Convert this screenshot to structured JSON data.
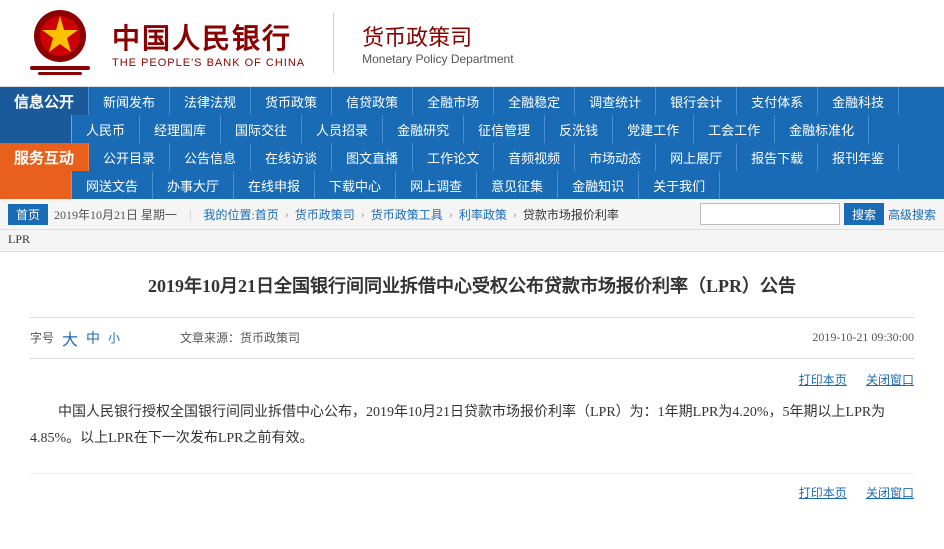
{
  "header": {
    "logo_cn": "中国人民银行",
    "logo_en": "THE PEOPLE'S BANK OF CHINA",
    "dept_cn": "货币政策司",
    "dept_en": "Monetary Policy Department"
  },
  "nav": {
    "row1": {
      "section": "信息公开",
      "items": [
        "新闻发布",
        "法律法规",
        "货币政策",
        "信贷政策",
        "全融市场",
        "全融稳定",
        "调查统计",
        "银行会计",
        "支付体系",
        "金融科技"
      ]
    },
    "row2": {
      "items": [
        "人民币",
        "经理国库",
        "国际交往",
        "人员招录",
        "金融研究",
        "征信管理",
        "反洗钱",
        "党建工作",
        "工会工作",
        "金融标准化"
      ]
    },
    "row3": {
      "section": "服务互动",
      "items": [
        "公开目录",
        "公告信息",
        "在线访谈",
        "图文直播",
        "工作论文",
        "音频视频",
        "市场动态",
        "网上展厅",
        "报告下载",
        "报刊年鉴"
      ]
    },
    "row4": {
      "items": [
        "网送文告",
        "办事大厅",
        "在线申报",
        "下载中心",
        "网上调查",
        "意见征集",
        "金融知识",
        "关于我们"
      ]
    }
  },
  "breadcrumb": {
    "home": "首页",
    "date": "2019年10月21日 星期一",
    "position_label": "我的位置:首页",
    "links": [
      "货币政策司",
      "货币政策工具",
      "利率政策",
      "贷款市场报价利率"
    ],
    "sub_label": "LPR",
    "search_placeholder": "",
    "search_btn": "搜索",
    "advanced": "高级搜索"
  },
  "article": {
    "title": "2019年10月21日全国银行间同业拆借中心受权公布贷款市场报价利率（LPR）公告",
    "font_label": "字号",
    "font_large": "大",
    "font_medium": "中",
    "font_small": "小",
    "source_label": "文章来源：货币政策司",
    "date": "2019-10-21  09:30:00",
    "print": "打印本页",
    "close": "关闭窗口",
    "body": "中国人民银行授权全国银行间同业拆借中心公布，2019年10月21日贷款市场报价利率（LPR）为：1年期LPR为4.20%，5年期以上LPR为4.85%。以上LPR在下一次发布LPR之前有效。",
    "print2": "打印本页",
    "close2": "关闭窗口"
  },
  "colors": {
    "nav_blue": "#1a6bb5",
    "nav_orange": "#e8601c",
    "text_dark": "#333",
    "link_blue": "#1a6bb5"
  }
}
